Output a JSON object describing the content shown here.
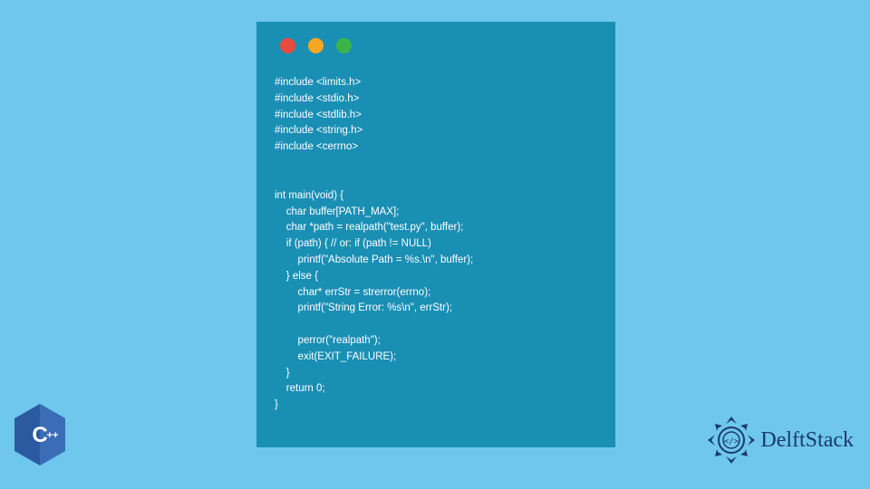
{
  "code": {
    "lines": [
      "#include <limits.h>",
      "#include <stdio.h>",
      "#include <stdlib.h>",
      "#include <string.h>",
      "#include <cerrno>",
      "",
      "",
      "int main(void) {",
      "    char buffer[PATH_MAX];",
      "    char *path = realpath(\"test.py\", buffer);",
      "    if (path) { // or: if (path != NULL)",
      "        printf(\"Absolute Path = %s.\\n\", buffer);",
      "    } else {",
      "        char* errStr = strerror(errno);",
      "        printf(\"String Error: %s\\n\", errStr);",
      "",
      "        perror(\"realpath\");",
      "        exit(EXIT_FAILURE);",
      "    }",
      "    return 0;",
      "}"
    ]
  },
  "badges": {
    "cpp_label": "C++",
    "brand_name": "DelftStack"
  },
  "colors": {
    "page_bg": "#6fc7ed",
    "window_bg": "#1a8fb4",
    "red": "#e94b3c",
    "yellow": "#f5a623",
    "green": "#3bb54a",
    "cpp_blue": "#2b5aa0",
    "delft_blue": "#1a3a6e"
  }
}
